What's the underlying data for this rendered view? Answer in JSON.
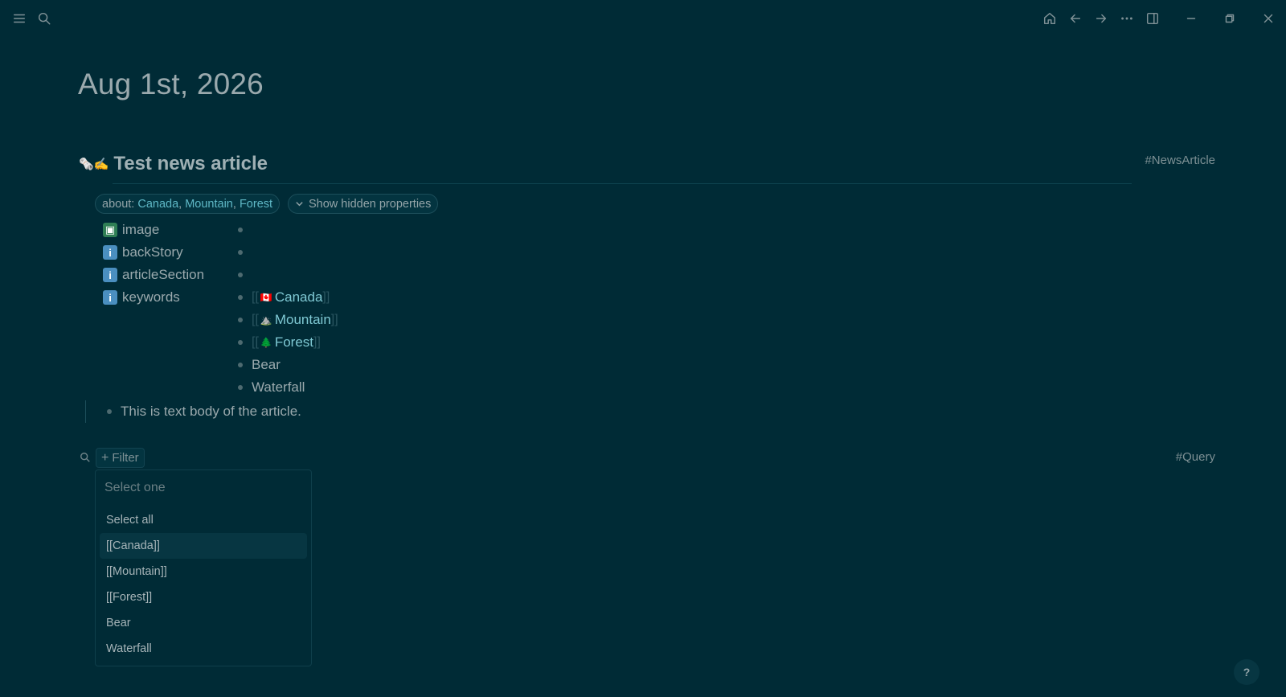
{
  "page": {
    "title": "Aug 1st, 2026"
  },
  "block": {
    "emoji": "🗞️✍️",
    "heading": "Test news article",
    "tag": "#NewsArticle",
    "about_prefix": "about:",
    "about_links": [
      "Canada",
      "Mountain",
      "Forest"
    ],
    "show_hidden": "Show hidden properties"
  },
  "properties": [
    {
      "icon": "image-icon",
      "emoji": "🖼️",
      "name": "image"
    },
    {
      "icon": "info-icon",
      "emoji": "ℹ️",
      "name": "backStory"
    },
    {
      "icon": "info-icon",
      "emoji": "ℹ️",
      "name": "articleSection"
    },
    {
      "icon": "info-icon",
      "emoji": "ℹ️",
      "name": "keywords"
    }
  ],
  "keyword_values": [
    {
      "label": "Canada",
      "emoji": "🇨🇦",
      "linked": true
    },
    {
      "label": "Mountain",
      "emoji": "⛰️",
      "linked": true
    },
    {
      "label": "Forest",
      "emoji": "🌲",
      "linked": true
    },
    {
      "label": "Bear",
      "emoji": "",
      "linked": false
    },
    {
      "label": "Waterfall",
      "emoji": "",
      "linked": false
    }
  ],
  "body_text": "This is text body of the article.",
  "query": {
    "tag": "#Query",
    "filter_label": "Filter",
    "select_placeholder": "Select one",
    "options": [
      "Select all",
      "[[Canada]]",
      "[[Mountain]]",
      "[[Forest]]",
      "Bear",
      "Waterfall"
    ],
    "active_option": "[[Canada]]"
  },
  "help_label": "?",
  "colors": {
    "background": "#002b36",
    "link": "#7fc9d4",
    "highlight": "#073642"
  }
}
